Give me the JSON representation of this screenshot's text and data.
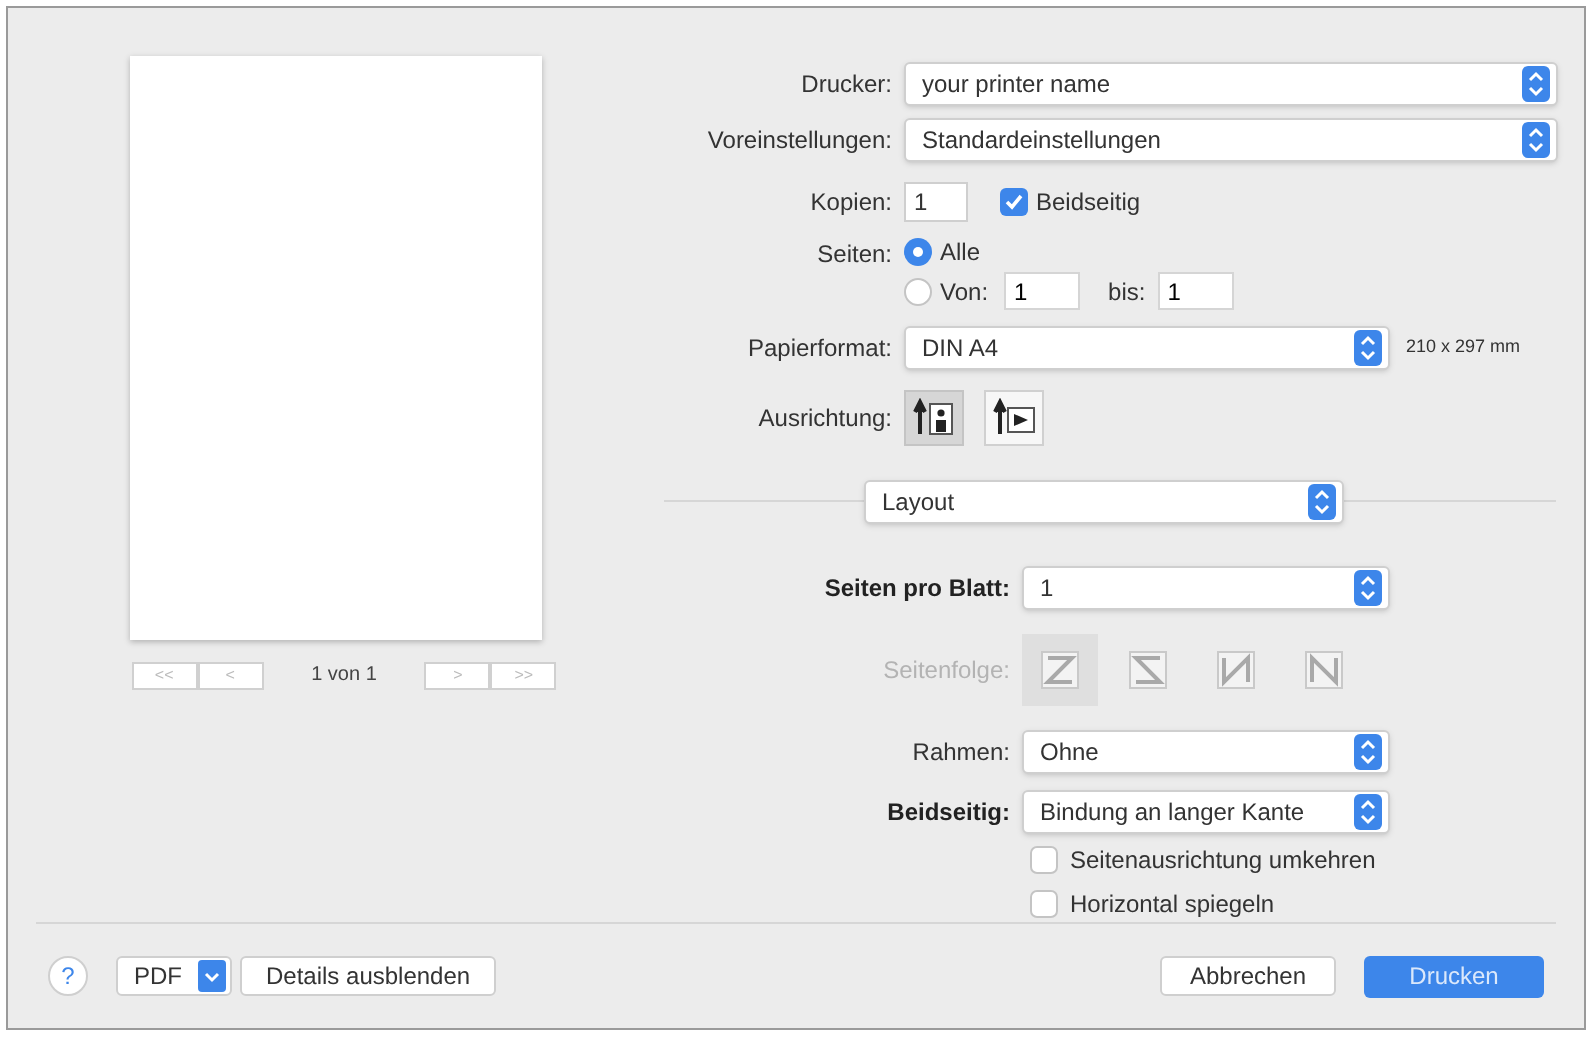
{
  "preview": {
    "nav_buttons": [
      "<<",
      "<",
      ">",
      ">>"
    ],
    "page_label": "1 von 1"
  },
  "printer": {
    "label": "Drucker:",
    "value": "your printer name"
  },
  "presets": {
    "label": "Voreinstellungen:",
    "value": "Standardeinstellungen"
  },
  "copies": {
    "label": "Kopien:",
    "value": "1"
  },
  "duplex": {
    "label": "Beidseitig",
    "checked": true
  },
  "pages": {
    "label": "Seiten:",
    "options": [
      {
        "label": "Alle",
        "selected": true
      },
      {
        "label": "Von:",
        "selected": false
      }
    ],
    "from": "1",
    "to_label": "bis:",
    "to": "1"
  },
  "paper": {
    "label": "Papierformat:",
    "value": "DIN A4",
    "size": "210 x 297 mm"
  },
  "orientation": {
    "label": "Ausrichtung:",
    "options": [
      {
        "kind": "portrait",
        "selected": true
      },
      {
        "kind": "landscape",
        "selected": false
      }
    ]
  },
  "panel_select": {
    "value": "Layout"
  },
  "layout": {
    "pages_per_sheet": {
      "label": "Seiten pro Blatt:",
      "value": "1"
    },
    "page_order": {
      "label": "Seitenfolge:",
      "disabled": true,
      "options": [
        {
          "kind": "z",
          "selected": true
        },
        {
          "kind": "s",
          "selected": false
        },
        {
          "kind": "n_reverse",
          "selected": false
        },
        {
          "kind": "n",
          "selected": false
        }
      ]
    },
    "border": {
      "label": "Rahmen:",
      "value": "Ohne"
    },
    "two_sided": {
      "label": "Beidseitig:",
      "value": "Bindung an langer Kante"
    },
    "checkboxes": [
      {
        "label": "Seitenausrichtung umkehren",
        "checked": false
      },
      {
        "label": "Horizontal spiegeln",
        "checked": false
      }
    ]
  },
  "footer": {
    "help": "?",
    "pdf": "PDF",
    "details": "Details ausblenden",
    "cancel": "Abbrechen",
    "print": "Drucken"
  }
}
